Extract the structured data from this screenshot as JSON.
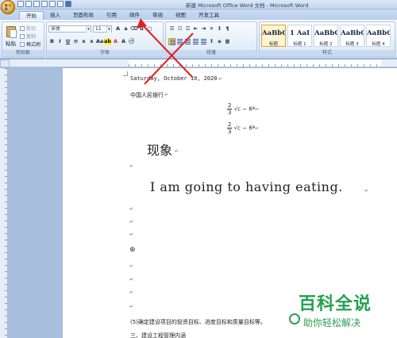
{
  "window": {
    "title": "新建 Microsoft Office Word 文档 - Microsoft Word"
  },
  "tabs": [
    {
      "label": "开始",
      "active": true
    },
    {
      "label": "插入"
    },
    {
      "label": "页面布局"
    },
    {
      "label": "引用"
    },
    {
      "label": "邮件"
    },
    {
      "label": "审阅"
    },
    {
      "label": "视图"
    },
    {
      "label": "开发工具"
    }
  ],
  "clipboard": {
    "paste": "粘贴",
    "cut": "剪切",
    "copy": "复制",
    "format_painter": "格式刷",
    "group": "剪贴板"
  },
  "font": {
    "name": "宋体",
    "size": "11",
    "group": "字体"
  },
  "paragraph": {
    "group": "段落"
  },
  "styles": {
    "group": "样式",
    "items": [
      {
        "sample": "AaBbC",
        "name": "标题",
        "selected": true
      },
      {
        "sample": "1 AaI",
        "name": "标题 1"
      },
      {
        "sample": "AaBbC",
        "name": "标题 2"
      },
      {
        "sample": "AaBbC",
        "name": "标题 3"
      },
      {
        "sample": "AaBbC",
        "name": "标题 4"
      }
    ]
  },
  "document": {
    "date_line": "Saturday, October 10, 2020",
    "bank_line": "中国人民银行",
    "formula_num": "2",
    "formula_den": "3",
    "formula_rest": "√c − 6ª",
    "phenomenon": "现象",
    "english_line": "I am going to having eating.",
    "item5": "(5)确定建设项目的投资目标、进度目标和质量目标等。",
    "item_three": "三、建设工程管理内涵"
  },
  "watermark": {
    "title": "百科全说",
    "subtitle": "助你轻松解决"
  },
  "colors": {
    "accent": "#dd2222",
    "watermark": "#23a14f"
  }
}
